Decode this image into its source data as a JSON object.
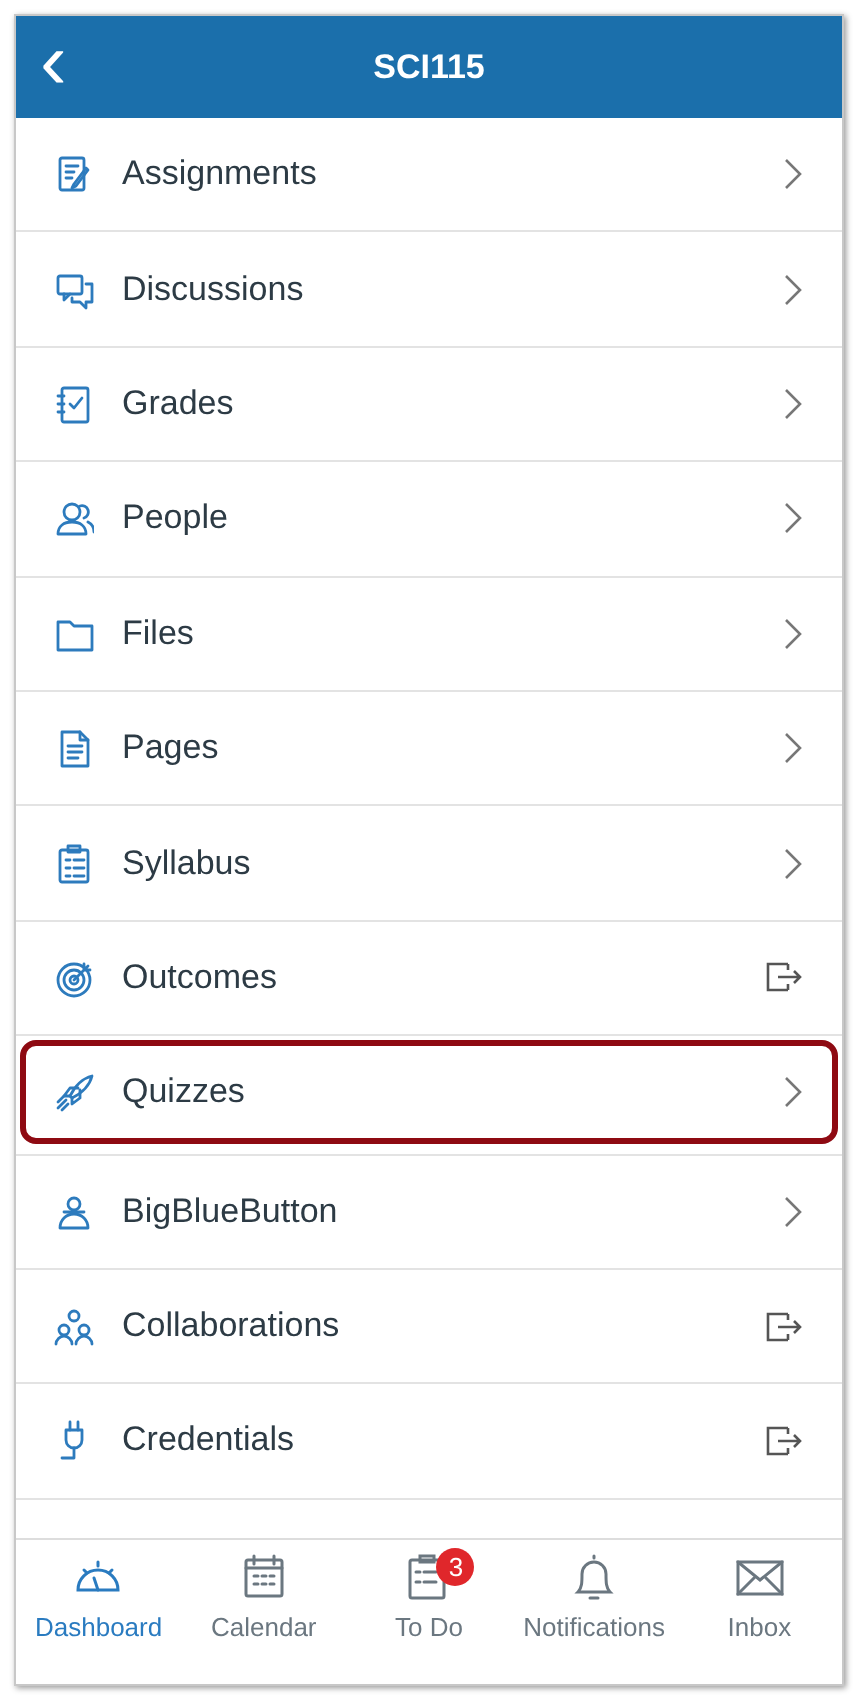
{
  "header": {
    "back": "‹",
    "title": "SCI115"
  },
  "menu": [
    {
      "label": "Assignments",
      "kind": "chevron",
      "highlighted": false
    },
    {
      "label": "Discussions",
      "kind": "chevron",
      "highlighted": false
    },
    {
      "label": "Grades",
      "kind": "chevron",
      "highlighted": false
    },
    {
      "label": "People",
      "kind": "chevron",
      "highlighted": false
    },
    {
      "label": "Files",
      "kind": "chevron",
      "highlighted": false
    },
    {
      "label": "Pages",
      "kind": "chevron",
      "highlighted": false
    },
    {
      "label": "Syllabus",
      "kind": "chevron",
      "highlighted": false
    },
    {
      "label": "Outcomes",
      "kind": "external",
      "highlighted": false
    },
    {
      "label": "Quizzes",
      "kind": "chevron",
      "highlighted": true
    },
    {
      "label": "BigBlueButton",
      "kind": "chevron",
      "highlighted": false
    },
    {
      "label": "Collaborations",
      "kind": "external",
      "highlighted": false
    },
    {
      "label": "Credentials",
      "kind": "external",
      "highlighted": false
    }
  ],
  "tab_bar": [
    {
      "label": "Dashboard",
      "selected": true
    },
    {
      "label": "Calendar",
      "selected": false
    },
    {
      "label": "To Do",
      "selected": false,
      "badge": "3"
    },
    {
      "label": "Notifications",
      "selected": false
    },
    {
      "label": "Inbox",
      "selected": false
    }
  ]
}
